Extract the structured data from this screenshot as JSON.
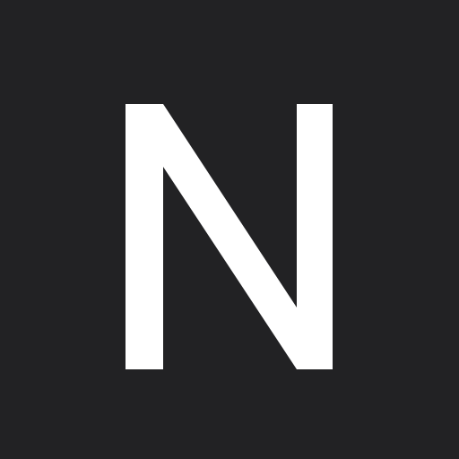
{
  "app_icon": {
    "letter": "N",
    "background_color": "#222224",
    "letter_color": "#FFFFFF",
    "icon_name": "letter-n-logo-icon"
  }
}
